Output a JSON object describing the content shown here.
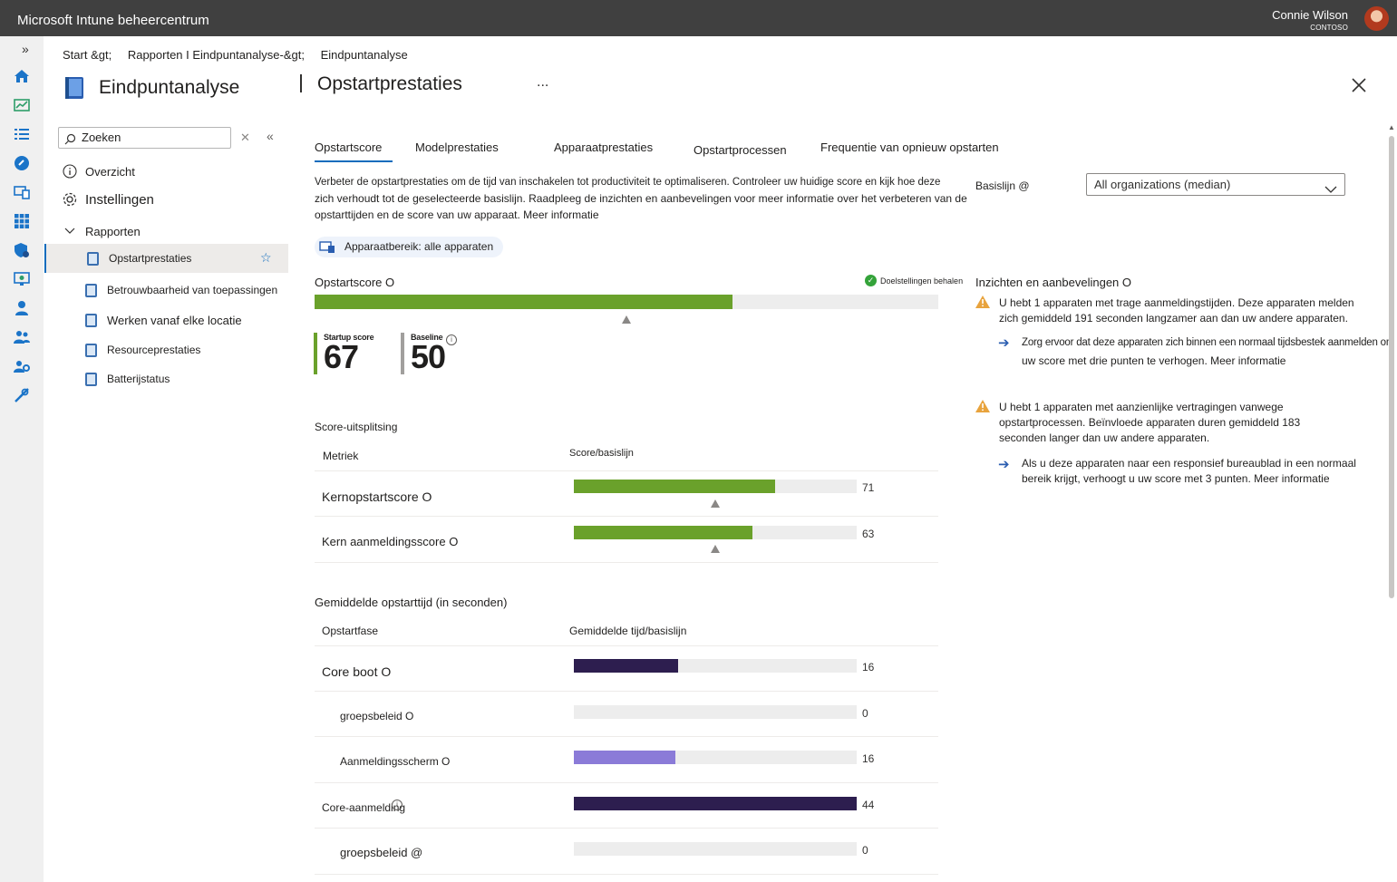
{
  "topbar": {
    "brand": "Microsoft Intune beheercentrum",
    "user_name": "Connie Wilson",
    "user_org": "CONTOSO"
  },
  "colors": {
    "green": "#6aa12b",
    "dark_purple": "#2d1e4f",
    "light_purple": "#8b7bd8",
    "accent": "#0f6cbd",
    "warning": "#e8a33d"
  },
  "breadcrumb": {
    "items": [
      "Start &gt;",
      "Rapporten I Eindpuntanalyse-&gt;",
      "Eindpuntanalyse"
    ]
  },
  "blade": {
    "title": "Eindpuntanalyse",
    "page_title": "Opstartprestaties",
    "more": "...",
    "close": "✕"
  },
  "search": {
    "placeholder": "Zoeken",
    "value": "Zoeken"
  },
  "nav": {
    "overview": "Overzicht",
    "settings": "Instellingen",
    "reports": "Rapporten",
    "sub_items": [
      {
        "label": "Opstartprestaties",
        "active": true
      },
      {
        "label": "Betrouwbaarheid van toepassingen"
      },
      {
        "label": "Werken vanaf elke locatie"
      },
      {
        "label": "Resourceprestaties"
      },
      {
        "label": "Batterijstatus"
      }
    ]
  },
  "tabs": [
    "Opstartscore",
    "Modelprestaties",
    "Apparaatprestaties",
    "Opstartprocessen",
    "Frequentie van opnieuw opstarten"
  ],
  "intro": {
    "line1": "Verbeter de opstartprestaties om de tijd van inschakelen tot productiviteit te optimaliseren. Controleer uw huidige score en kijk hoe deze",
    "line2": "zich verhoudt tot de geselecteerde basislijn. Raadpleeg de inzichten en aanbevelingen voor meer informatie over het verbeteren van de",
    "line3": "opstarttijden en de score van uw apparaat. Meer informatie"
  },
  "baseline": {
    "label": "Basislijn @",
    "selected": "All organizations (median)"
  },
  "scope_pill": "Apparaatbereik: alle apparaten",
  "score": {
    "label": "Opstartscore O",
    "goals": "Doelstellingen behalen",
    "value_fraction": 0.67,
    "baseline_fraction": 0.5,
    "startup_label": "Startup score",
    "startup_value": "67",
    "baseline_label": "Baseline",
    "baseline_value": "50"
  },
  "breakdown": {
    "title": "Score-uitsplitsing",
    "col_metric": "Metriek",
    "col_score": "Score/basislijn",
    "rows": [
      {
        "label": "Kernopstartscore O",
        "value": "71",
        "fraction": 0.71,
        "baseline_fraction": 0.5
      },
      {
        "label": "Kern aanmeldingsscore O",
        "value": "63",
        "fraction": 0.63,
        "baseline_fraction": 0.5
      }
    ]
  },
  "boot_times": {
    "title": "Gemiddelde opstarttijd (in seconden)",
    "col_phase": "Opstartfase",
    "col_time": "Gemiddelde tijd/basislijn",
    "rows": [
      {
        "label": "Core boot O",
        "value": "16",
        "fraction": 0.37
      },
      {
        "label": "groepsbeleid O",
        "value": "0",
        "fraction": 0
      },
      {
        "label": "Aanmeldingsscherm O",
        "value": "16",
        "fraction": 0.36
      },
      {
        "label": "Core-aanmelding",
        "value": "44",
        "fraction": 1.0
      },
      {
        "label": "groepsbeleid @",
        "value": "0",
        "fraction": 0
      }
    ]
  },
  "insights": {
    "title": "Inzichten en aanbevelingen O",
    "items": [
      {
        "line1": "U hebt 1 apparaten met trage aanmeldingstijden. Deze apparaten melden",
        "line2": "zich gemiddeld 191 seconden langzamer aan dan uw andere apparaten.",
        "rec1": "Zorg ervoor dat deze apparaten zich binnen een normaal tijdsbestek aanmelden om",
        "rec2": "uw score met drie punten te verhogen. Meer informatie"
      },
      {
        "line1": "U hebt 1 apparaten met aanzienlijke vertragingen vanwege",
        "line2": "opstartprocessen. Beïnvloede apparaten duren gemiddeld 183",
        "line3": "seconden langer dan uw andere apparaten.",
        "rec1": "Als u deze apparaten naar een responsief bureaublad in een normaal",
        "rec2": "bereik krijgt, verhoogt u uw score met 3 punten. Meer informatie"
      }
    ]
  }
}
